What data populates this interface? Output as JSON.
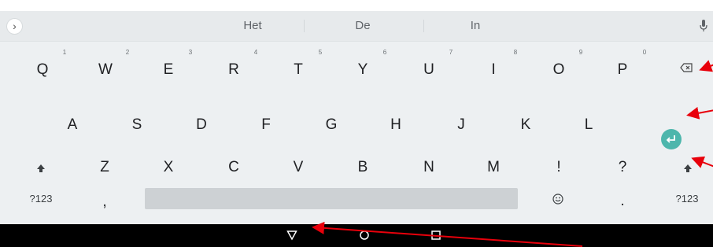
{
  "suggestions": [
    "Het",
    "De",
    "In"
  ],
  "keyboard": {
    "row1": [
      {
        "label": "Q",
        "hint": "1"
      },
      {
        "label": "W",
        "hint": "2"
      },
      {
        "label": "E",
        "hint": "3"
      },
      {
        "label": "R",
        "hint": "4"
      },
      {
        "label": "T",
        "hint": "5"
      },
      {
        "label": "Y",
        "hint": "6"
      },
      {
        "label": "U",
        "hint": "7"
      },
      {
        "label": "I",
        "hint": "8"
      },
      {
        "label": "O",
        "hint": "9"
      },
      {
        "label": "P",
        "hint": "0"
      }
    ],
    "row2": [
      "A",
      "S",
      "D",
      "F",
      "G",
      "H",
      "J",
      "K",
      "L"
    ],
    "row3": [
      "Z",
      "X",
      "C",
      "V",
      "B",
      "N",
      "M",
      "!",
      "?"
    ],
    "bottom": {
      "symbols_left": "?123",
      "comma": ",",
      "period": ".",
      "symbols_right": "?123"
    }
  },
  "icons": {
    "expand": "chevron-right-icon",
    "mic": "microphone-icon",
    "backspace": "backspace-icon",
    "enter": "enter-icon",
    "shift": "shift-icon",
    "emoji": "emoji-icon",
    "back": "back-triangle-icon",
    "home": "home-circle-icon",
    "recents": "recents-square-icon"
  },
  "colors": {
    "keyboard_bg": "#edf0f2",
    "enter_accent": "#4db6ac",
    "annotation_arrow": "#e8000b"
  }
}
